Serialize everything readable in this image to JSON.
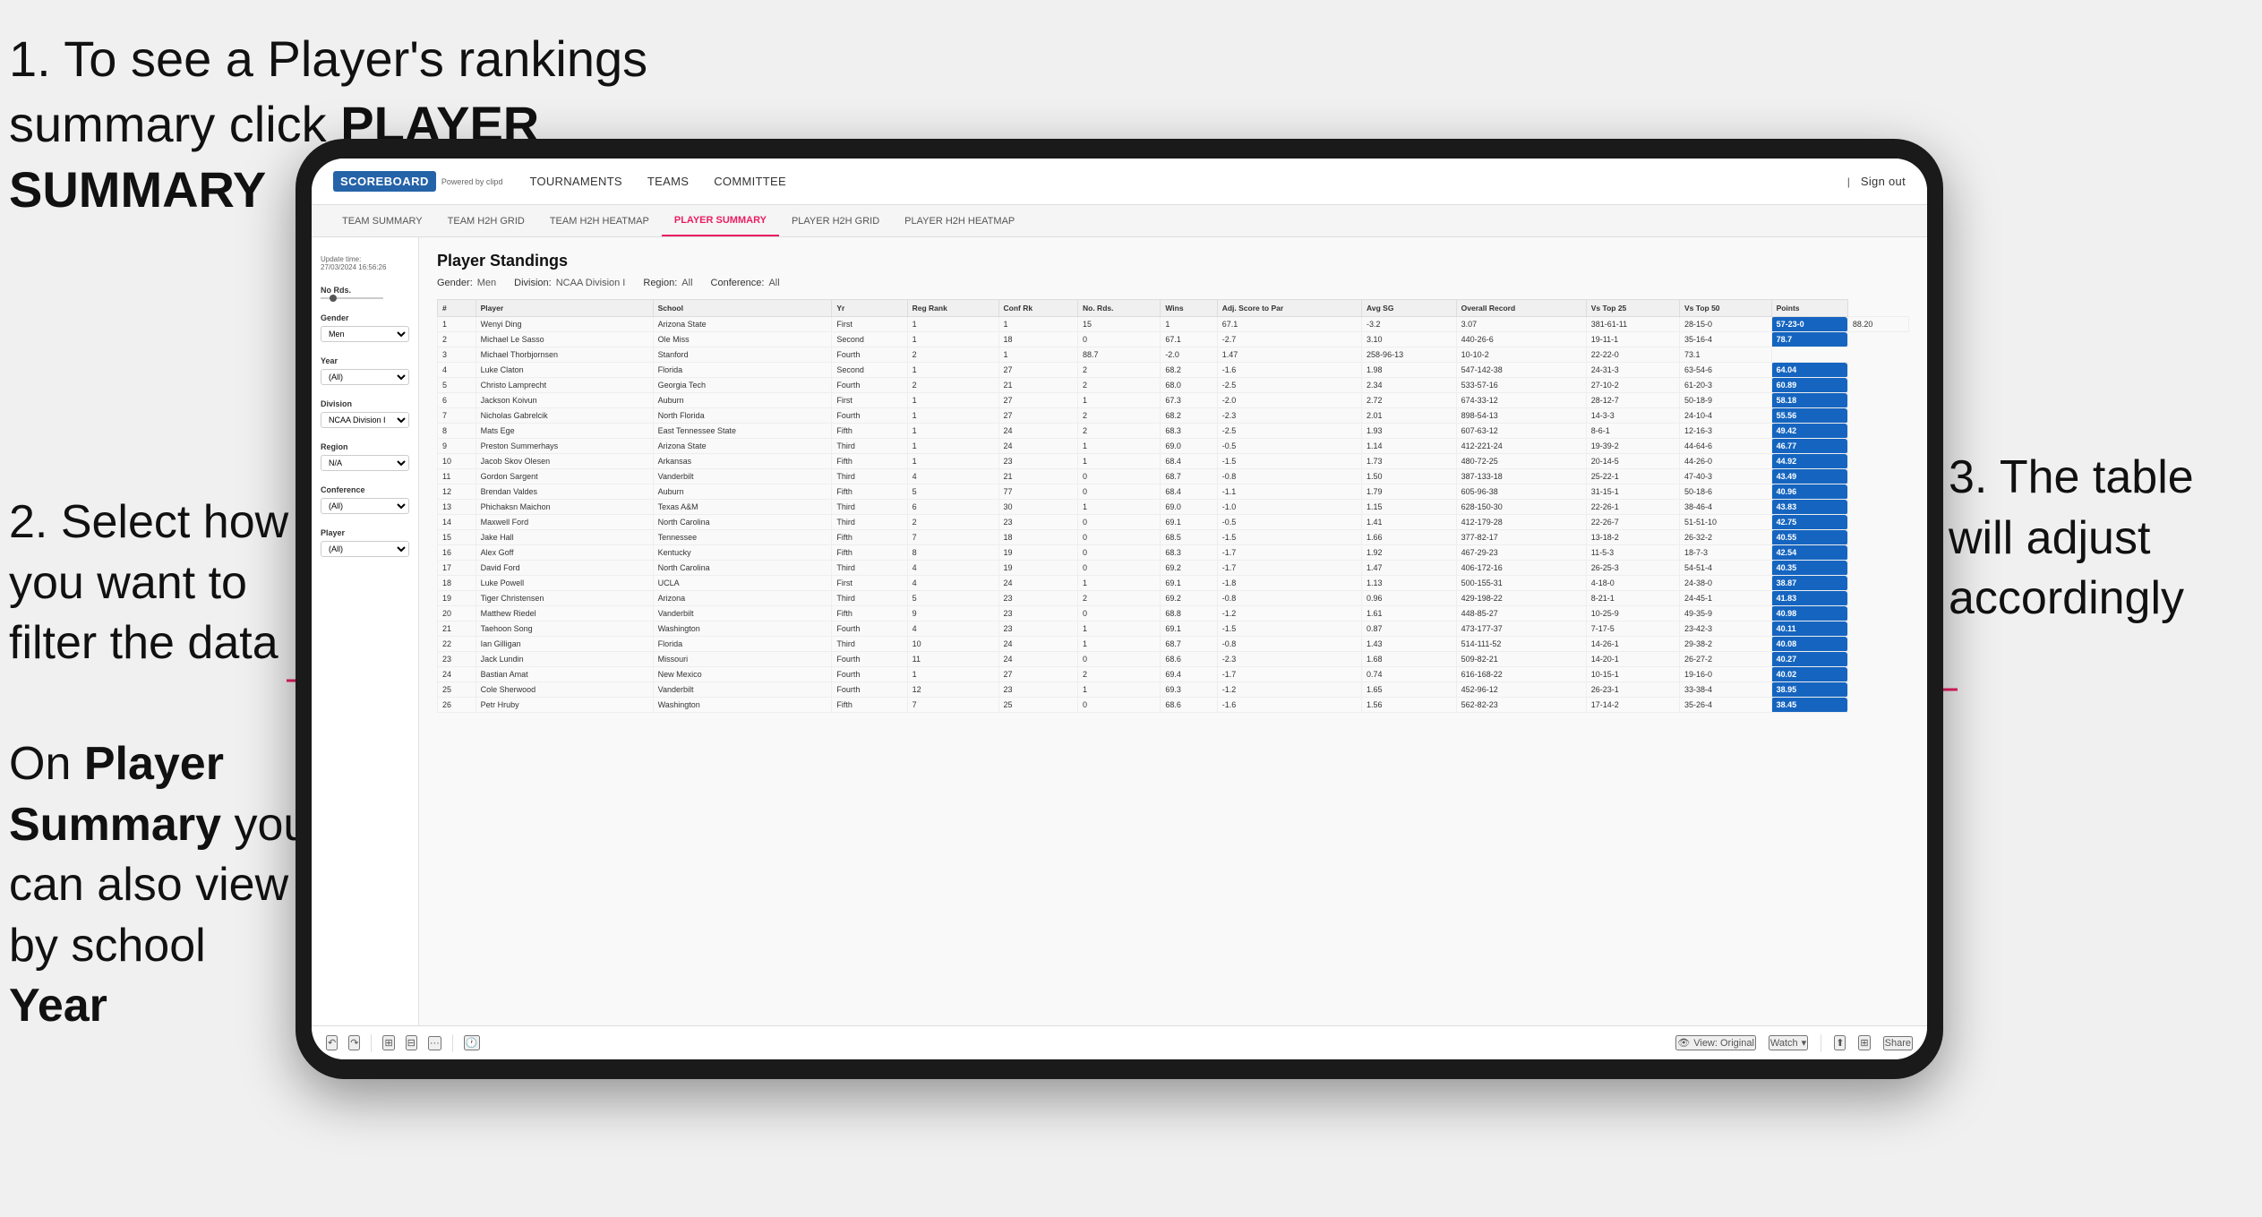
{
  "annotations": {
    "step1_text": "1. To see a Player's rankings summary click ",
    "step1_bold": "PLAYER SUMMARY",
    "step2_text": "2. Select how you want to filter the data",
    "step2_note_pre": "On ",
    "step2_note_bold1": "Player Summary",
    "step2_note_mid": " you can also view by school ",
    "step2_note_bold2": "Year",
    "step3_text": "3. The table will adjust accordingly"
  },
  "nav": {
    "logo": "SCOREBOARD",
    "logo_sub": "Powered by clipd",
    "items": [
      "TOURNAMENTS",
      "TEAMS",
      "COMMITTEE"
    ],
    "sign_out": "Sign out"
  },
  "sub_nav": {
    "items": [
      "TEAM SUMMARY",
      "TEAM H2H GRID",
      "TEAM H2H HEATMAP",
      "PLAYER SUMMARY",
      "PLAYER H2H GRID",
      "PLAYER H2H HEATMAP"
    ],
    "active": "PLAYER SUMMARY"
  },
  "sidebar": {
    "update_label": "Update time:",
    "update_time": "27/03/2024 16:56:26",
    "no_rds_label": "No Rds.",
    "gender_label": "Gender",
    "gender_value": "Men",
    "year_label": "Year",
    "year_value": "(All)",
    "division_label": "Division",
    "division_value": "NCAA Division I",
    "region_label": "Region",
    "region_value": "N/A",
    "conference_label": "Conference",
    "conference_value": "(All)",
    "player_label": "Player",
    "player_value": "(All)"
  },
  "standings": {
    "title": "Player Standings",
    "gender": "Men",
    "division": "NCAA Division I",
    "region": "All",
    "conference": "All",
    "columns": [
      "#",
      "Player",
      "School",
      "Yr",
      "Reg Rank",
      "Conf Rk",
      "No. Rds.",
      "Wins",
      "Adj. Score to Par",
      "Avg SG",
      "Overall Record",
      "Vs Top 25",
      "Vs Top 50",
      "Points"
    ],
    "rows": [
      [
        "1",
        "Wenyi Ding",
        "Arizona State",
        "First",
        "1",
        "1",
        "15",
        "1",
        "67.1",
        "-3.2",
        "3.07",
        "381-61-11",
        "28-15-0",
        "57-23-0",
        "88.20"
      ],
      [
        "2",
        "Michael Le Sasso",
        "Ole Miss",
        "Second",
        "1",
        "18",
        "0",
        "67.1",
        "-2.7",
        "3.10",
        "440-26-6",
        "19-11-1",
        "35-16-4",
        "78.7"
      ],
      [
        "3",
        "Michael Thorbjornsen",
        "Stanford",
        "Fourth",
        "2",
        "1",
        "88.7",
        "-2.0",
        "1.47",
        "258-96-13",
        "10-10-2",
        "22-22-0",
        "73.1"
      ],
      [
        "4",
        "Luke Claton",
        "Florida",
        "Second",
        "1",
        "27",
        "2",
        "68.2",
        "-1.6",
        "1.98",
        "547-142-38",
        "24-31-3",
        "63-54-6",
        "64.04"
      ],
      [
        "5",
        "Christo Lamprecht",
        "Georgia Tech",
        "Fourth",
        "2",
        "21",
        "2",
        "68.0",
        "-2.5",
        "2.34",
        "533-57-16",
        "27-10-2",
        "61-20-3",
        "60.89"
      ],
      [
        "6",
        "Jackson Koivun",
        "Auburn",
        "First",
        "1",
        "27",
        "1",
        "67.3",
        "-2.0",
        "2.72",
        "674-33-12",
        "28-12-7",
        "50-18-9",
        "58.18"
      ],
      [
        "7",
        "Nicholas Gabrelcik",
        "North Florida",
        "Fourth",
        "1",
        "27",
        "2",
        "68.2",
        "-2.3",
        "2.01",
        "898-54-13",
        "14-3-3",
        "24-10-4",
        "55.56"
      ],
      [
        "8",
        "Mats Ege",
        "East Tennessee State",
        "Fifth",
        "1",
        "24",
        "2",
        "68.3",
        "-2.5",
        "1.93",
        "607-63-12",
        "8-6-1",
        "12-16-3",
        "49.42"
      ],
      [
        "9",
        "Preston Summerhays",
        "Arizona State",
        "Third",
        "1",
        "24",
        "1",
        "69.0",
        "-0.5",
        "1.14",
        "412-221-24",
        "19-39-2",
        "44-64-6",
        "46.77"
      ],
      [
        "10",
        "Jacob Skov Olesen",
        "Arkansas",
        "Fifth",
        "1",
        "23",
        "1",
        "68.4",
        "-1.5",
        "1.73",
        "480-72-25",
        "20-14-5",
        "44-26-0",
        "44.92"
      ],
      [
        "11",
        "Gordon Sargent",
        "Vanderbilt",
        "Third",
        "4",
        "21",
        "0",
        "68.7",
        "-0.8",
        "1.50",
        "387-133-18",
        "25-22-1",
        "47-40-3",
        "43.49"
      ],
      [
        "12",
        "Brendan Valdes",
        "Auburn",
        "Fifth",
        "5",
        "77",
        "0",
        "68.4",
        "-1.1",
        "1.79",
        "605-96-38",
        "31-15-1",
        "50-18-6",
        "40.96"
      ],
      [
        "13",
        "Phichaksn Maichon",
        "Texas A&M",
        "Third",
        "6",
        "30",
        "1",
        "69.0",
        "-1.0",
        "1.15",
        "628-150-30",
        "22-26-1",
        "38-46-4",
        "43.83"
      ],
      [
        "14",
        "Maxwell Ford",
        "North Carolina",
        "Third",
        "2",
        "23",
        "0",
        "69.1",
        "-0.5",
        "1.41",
        "412-179-28",
        "22-26-7",
        "51-51-10",
        "42.75"
      ],
      [
        "15",
        "Jake Hall",
        "Tennessee",
        "Fifth",
        "7",
        "18",
        "0",
        "68.5",
        "-1.5",
        "1.66",
        "377-82-17",
        "13-18-2",
        "26-32-2",
        "40.55"
      ],
      [
        "16",
        "Alex Goff",
        "Kentucky",
        "Fifth",
        "8",
        "19",
        "0",
        "68.3",
        "-1.7",
        "1.92",
        "467-29-23",
        "11-5-3",
        "18-7-3",
        "42.54"
      ],
      [
        "17",
        "David Ford",
        "North Carolina",
        "Third",
        "4",
        "19",
        "0",
        "69.2",
        "-1.7",
        "1.47",
        "406-172-16",
        "26-25-3",
        "54-51-4",
        "40.35"
      ],
      [
        "18",
        "Luke Powell",
        "UCLA",
        "First",
        "4",
        "24",
        "1",
        "69.1",
        "-1.8",
        "1.13",
        "500-155-31",
        "4-18-0",
        "24-38-0",
        "38.87"
      ],
      [
        "19",
        "Tiger Christensen",
        "Arizona",
        "Third",
        "5",
        "23",
        "2",
        "69.2",
        "-0.8",
        "0.96",
        "429-198-22",
        "8-21-1",
        "24-45-1",
        "41.83"
      ],
      [
        "20",
        "Matthew Riedel",
        "Vanderbilt",
        "Fifth",
        "9",
        "23",
        "0",
        "68.8",
        "-1.2",
        "1.61",
        "448-85-27",
        "10-25-9",
        "49-35-9",
        "40.98"
      ],
      [
        "21",
        "Taehoon Song",
        "Washington",
        "Fourth",
        "4",
        "23",
        "1",
        "69.1",
        "-1.5",
        "0.87",
        "473-177-37",
        "7-17-5",
        "23-42-3",
        "40.11"
      ],
      [
        "22",
        "Ian Gilligan",
        "Florida",
        "Third",
        "10",
        "24",
        "1",
        "68.7",
        "-0.8",
        "1.43",
        "514-111-52",
        "14-26-1",
        "29-38-2",
        "40.08"
      ],
      [
        "23",
        "Jack Lundin",
        "Missouri",
        "Fourth",
        "11",
        "24",
        "0",
        "68.6",
        "-2.3",
        "1.68",
        "509-82-21",
        "14-20-1",
        "26-27-2",
        "40.27"
      ],
      [
        "24",
        "Bastian Amat",
        "New Mexico",
        "Fourth",
        "1",
        "27",
        "2",
        "69.4",
        "-1.7",
        "0.74",
        "616-168-22",
        "10-15-1",
        "19-16-0",
        "40.02"
      ],
      [
        "25",
        "Cole Sherwood",
        "Vanderbilt",
        "Fourth",
        "12",
        "23",
        "1",
        "69.3",
        "-1.2",
        "1.65",
        "452-96-12",
        "26-23-1",
        "33-38-4",
        "38.95"
      ],
      [
        "26",
        "Petr Hruby",
        "Washington",
        "Fifth",
        "7",
        "25",
        "0",
        "68.6",
        "-1.6",
        "1.56",
        "562-82-23",
        "17-14-2",
        "35-26-4",
        "38.45"
      ]
    ]
  },
  "toolbar": {
    "view_label": "View: Original",
    "watch_label": "Watch",
    "share_label": "Share"
  }
}
